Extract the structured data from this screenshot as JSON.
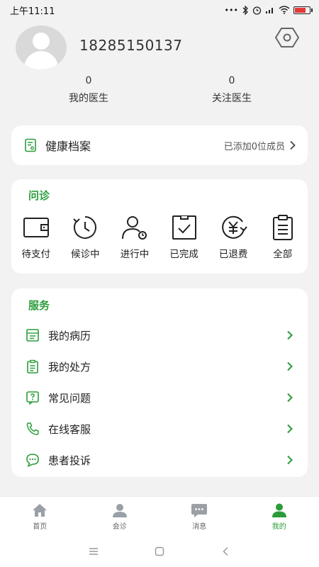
{
  "status_bar": {
    "time": "上午11:11",
    "icons": [
      "dots-icon",
      "bluetooth-icon",
      "alarm-icon",
      "signal-icon",
      "wifi-icon",
      "battery-icon"
    ]
  },
  "profile": {
    "phone": "18285150137",
    "stats": [
      {
        "value": "0",
        "label": "我的医生"
      },
      {
        "value": "0",
        "label": "关注医生"
      }
    ]
  },
  "health_record": {
    "title": "健康档案",
    "subtitle": "已添加0位成员"
  },
  "consult": {
    "title": "问诊",
    "items": [
      {
        "label": "待支付",
        "icon": "wallet-icon"
      },
      {
        "label": "候诊中",
        "icon": "clock-refresh-icon"
      },
      {
        "label": "进行中",
        "icon": "person-progress-icon"
      },
      {
        "label": "已完成",
        "icon": "checkbox-icon"
      },
      {
        "label": "已退费",
        "icon": "refund-icon"
      },
      {
        "label": "全部",
        "icon": "clipboard-icon"
      }
    ]
  },
  "services": {
    "title": "服务",
    "items": [
      {
        "label": "我的病历",
        "icon": "medical-record-icon"
      },
      {
        "label": "我的处方",
        "icon": "prescription-icon"
      },
      {
        "label": "常见问题",
        "icon": "question-icon"
      },
      {
        "label": "在线客服",
        "icon": "phone-icon"
      },
      {
        "label": "患者投诉",
        "icon": "chat-icon"
      }
    ]
  },
  "bottom_nav": {
    "items": [
      {
        "label": "首页",
        "icon": "home-icon",
        "active": false
      },
      {
        "label": "会诊",
        "icon": "consult-icon",
        "active": false
      },
      {
        "label": "消息",
        "icon": "message-icon",
        "active": false
      },
      {
        "label": "我的",
        "icon": "profile-icon",
        "active": true
      }
    ]
  },
  "colors": {
    "accent": "#2a9d3a",
    "background": "#f2f2f3",
    "card": "#ffffff"
  }
}
